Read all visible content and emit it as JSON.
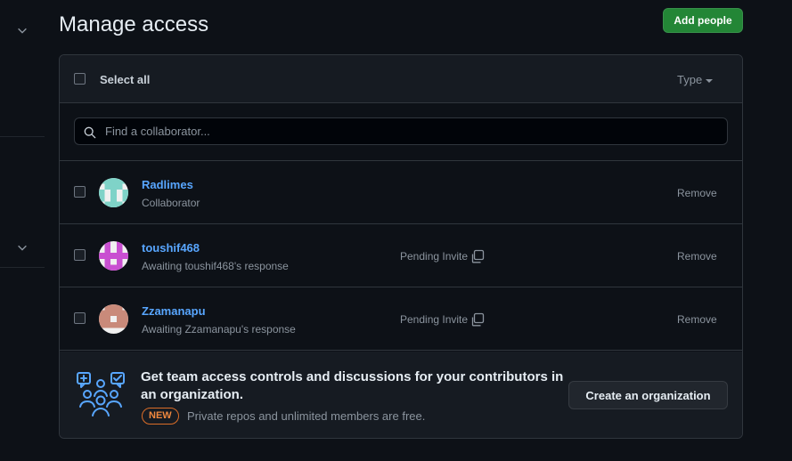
{
  "page": {
    "title": "Manage access",
    "add_button": "Add people"
  },
  "header": {
    "select_all": "Select all",
    "type_filter": "Type"
  },
  "search": {
    "placeholder": "Find a collaborator...",
    "value": ""
  },
  "collaborators": [
    {
      "username": "Radlimes",
      "status": "Collaborator",
      "pending": "",
      "remove": "Remove",
      "avatar_color": "#7fd3c8"
    },
    {
      "username": "toushif468",
      "status": "Awaiting toushif468's response",
      "pending": "Pending Invite",
      "remove": "Remove",
      "avatar_color": "#c94fd1"
    },
    {
      "username": "Zzamanapu",
      "status": "Awaiting Zzamanapu's response",
      "pending": "Pending Invite",
      "remove": "Remove",
      "avatar_color": "#c98a7a"
    }
  ],
  "promo": {
    "title": "Get team access controls and discussions for your contributors in an organization.",
    "badge": "NEW",
    "subtitle": "Private repos and unlimited members are free.",
    "button": "Create an organization"
  },
  "colors": {
    "primary_button": "#238636",
    "link": "#58a6ff",
    "badge": "#f0883e",
    "background": "#0d1117"
  },
  "icons": [
    "chevron-down-icon",
    "search-icon",
    "copy-icon",
    "caret-down-icon",
    "people-icon"
  ]
}
